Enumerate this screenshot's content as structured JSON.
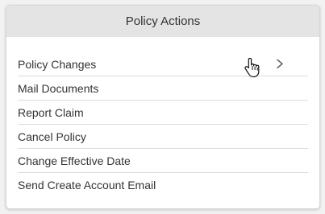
{
  "panel": {
    "title": "Policy Actions",
    "items": [
      {
        "label": "Policy Changes",
        "icon": "chevron-right-icon"
      },
      {
        "label": "Mail Documents"
      },
      {
        "label": "Report Claim"
      },
      {
        "label": "Cancel Policy"
      },
      {
        "label": "Change Effective Date"
      },
      {
        "label": "Send Create Account Email"
      }
    ]
  },
  "colors": {
    "header_bg": "#e4e4e4",
    "text": "#333333",
    "divider": "#dcdcdc",
    "card_bg": "#ffffff"
  }
}
